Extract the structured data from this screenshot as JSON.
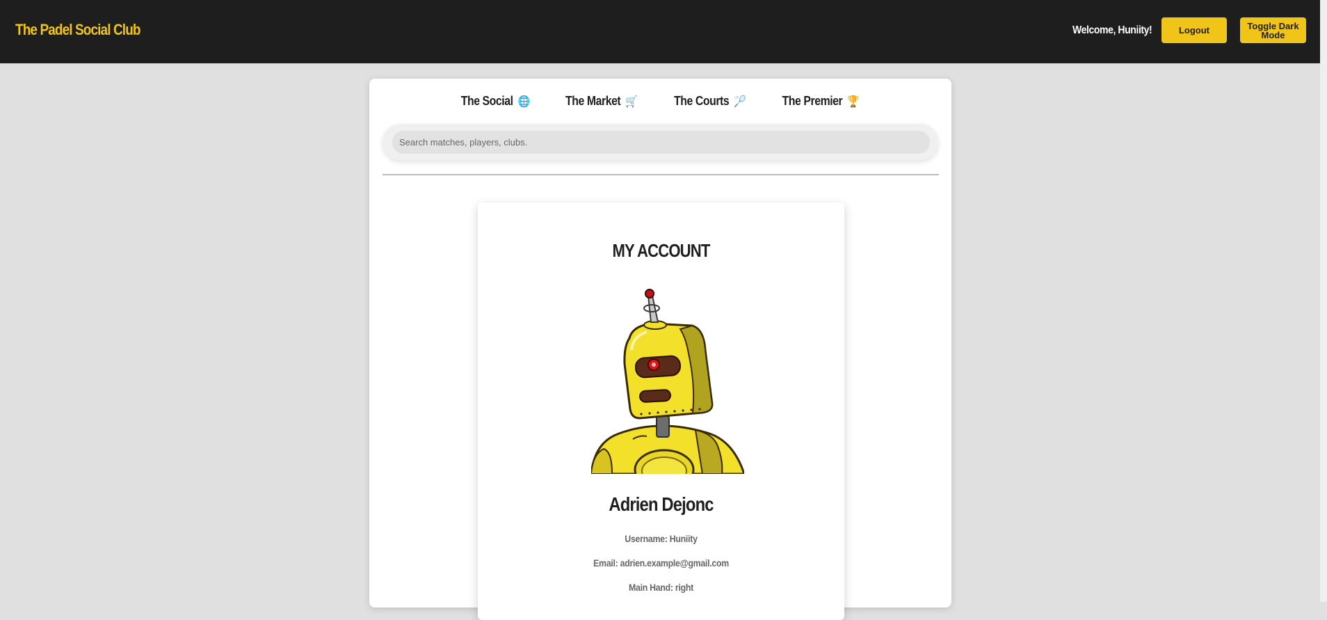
{
  "header": {
    "brand": "The Padel Social Club",
    "welcome": "Welcome, Huniity!",
    "logout_label": "Logout",
    "dark_mode_label": "Toggle Dark Mode"
  },
  "nav": {
    "items": [
      {
        "label": "The Social",
        "icon": "🌐",
        "icon_name": "globe-icon"
      },
      {
        "label": "The Market",
        "icon": "🛒",
        "icon_name": "cart-icon"
      },
      {
        "label": "The Courts",
        "icon": "🏸",
        "icon_name": "racket-icon"
      },
      {
        "label": "The Premier",
        "icon": "🏆",
        "icon_name": "trophy-icon"
      }
    ]
  },
  "search": {
    "placeholder": "Search matches, players, clubs.",
    "value": ""
  },
  "account": {
    "title": "MY ACCOUNT",
    "avatar": "robot-avatar",
    "name": "Adrien Dejonc",
    "username_line": "Username: Huniity",
    "email_line": "Email: adrien.example@gmail.com",
    "hand_line": "Main Hand: right"
  },
  "colors": {
    "accent": "#f0c419",
    "topbar": "#1e1e1e",
    "background": "#e0e0e0"
  }
}
